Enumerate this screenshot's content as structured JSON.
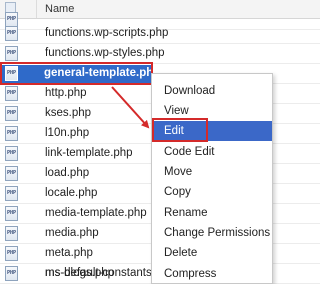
{
  "header": {
    "name_column": "Name"
  },
  "files": [
    {
      "name": ""
    },
    {
      "name": "functions.wp-scripts.php"
    },
    {
      "name": "functions.wp-styles.php"
    },
    {
      "name": "general-template.php",
      "selected": true
    },
    {
      "name": "http.php"
    },
    {
      "name": "kses.php"
    },
    {
      "name": "l10n.php"
    },
    {
      "name": "link-template.php"
    },
    {
      "name": "load.php"
    },
    {
      "name": "locale.php"
    },
    {
      "name": "media-template.php"
    },
    {
      "name": "media.php"
    },
    {
      "name": "meta.php"
    },
    {
      "name": "ms-blogs.php"
    },
    {
      "name": "ms-default-constants.php"
    }
  ],
  "file_icon_text": "PHP",
  "context_menu": {
    "items": [
      "Download",
      "View",
      "Edit",
      "Code Edit",
      "Move",
      "Copy",
      "Rename",
      "Change Permissions",
      "Delete",
      "Compress"
    ],
    "active_item": "Edit"
  },
  "colors": {
    "selection": "#2f6ac9",
    "menu_highlight": "#3b68c8",
    "annotation_red": "#d42a2a"
  }
}
